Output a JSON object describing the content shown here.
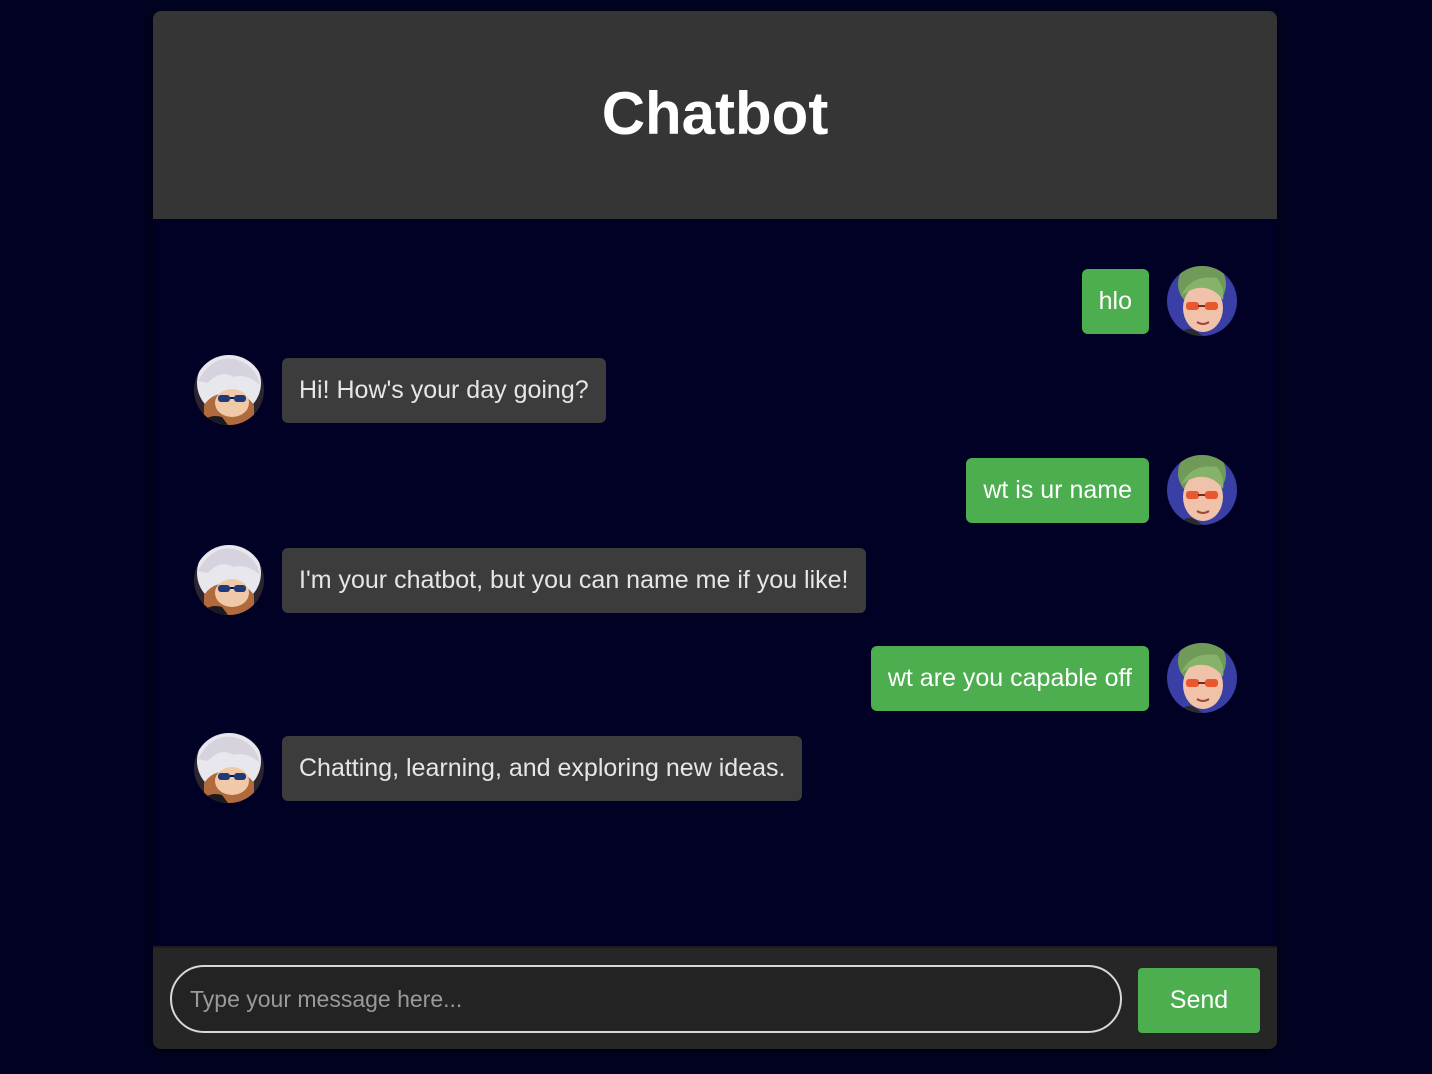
{
  "header": {
    "title": "Chatbot",
    "theme_toggle_icon": "moon-icon"
  },
  "messages": [
    {
      "sender": "user",
      "text": "hlo",
      "avatar": "user-avatar"
    },
    {
      "sender": "bot",
      "text": "Hi! How's your day going?",
      "avatar": "bot-avatar"
    },
    {
      "sender": "user",
      "text": "wt is ur name",
      "avatar": "user-avatar"
    },
    {
      "sender": "bot",
      "text": "I'm your chatbot, but you can name me if you like!",
      "avatar": "bot-avatar"
    },
    {
      "sender": "user",
      "text": "wt are you capable off",
      "avatar": "user-avatar"
    },
    {
      "sender": "bot",
      "text": "Chatting, learning, and exploring new ideas.",
      "avatar": "bot-avatar"
    }
  ],
  "input": {
    "placeholder": "Type your message here...",
    "value": ""
  },
  "send_button": {
    "label": "Send"
  },
  "colors": {
    "page_background": "#020322",
    "chat_background": "#010126",
    "header_background": "#353535",
    "user_bubble": "#4cae4f",
    "bot_bubble": "#3c3c3c",
    "accent": "#4cae4f",
    "moon": "#f5c518"
  }
}
